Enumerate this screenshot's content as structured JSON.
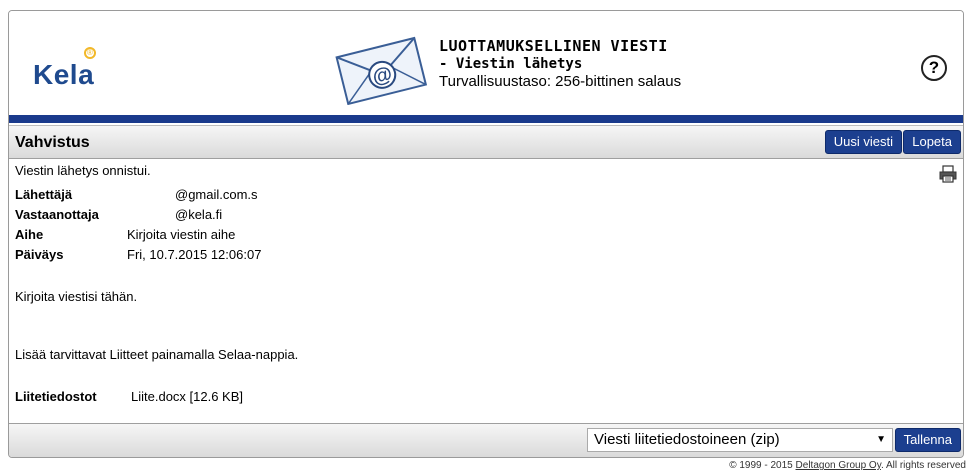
{
  "header": {
    "logo_text": "Kela",
    "logo_mark": "®",
    "title": "LUOTTAMUKSELLINEN VIESTI",
    "subtitle": "- Viestin lähetys",
    "security": "Turvallisuustaso: 256-bittinen salaus",
    "help_icon": "?",
    "brand_color": "#1a3a8c"
  },
  "titlebar": {
    "title": "Vahvistus",
    "new_message_button": "Uusi viesti",
    "quit_button": "Lopeta"
  },
  "content": {
    "status": "Viestin lähetys onnistui.",
    "fields": [
      {
        "label": "Lähettäjä",
        "value": "@gmail.com.s"
      },
      {
        "label": "Vastaanottaja",
        "value": "@kela.fi"
      },
      {
        "label": "Aihe",
        "value": "Kirjoita viestin aihe"
      },
      {
        "label": "Päiväys",
        "value": "Fri, 10.7.2015 12:06:07"
      }
    ],
    "body_text": "Kirjoita viestisi tähän.",
    "attachments_hint": "Lisää tarvittavat Liitteet painamalla Selaa-nappia.",
    "attachments_label": "Liitetiedostot",
    "attachments_value": "Liite.docx [12.6 KB]"
  },
  "bottombar": {
    "select_value": "Viesti liitetiedostoineen (zip)",
    "save_button": "Tallenna"
  },
  "footer": {
    "copyright_prefix": "© 1999 - 2015 ",
    "company_link": "Deltagon Group Oy",
    "copyright_suffix": ". All rights reserved"
  }
}
